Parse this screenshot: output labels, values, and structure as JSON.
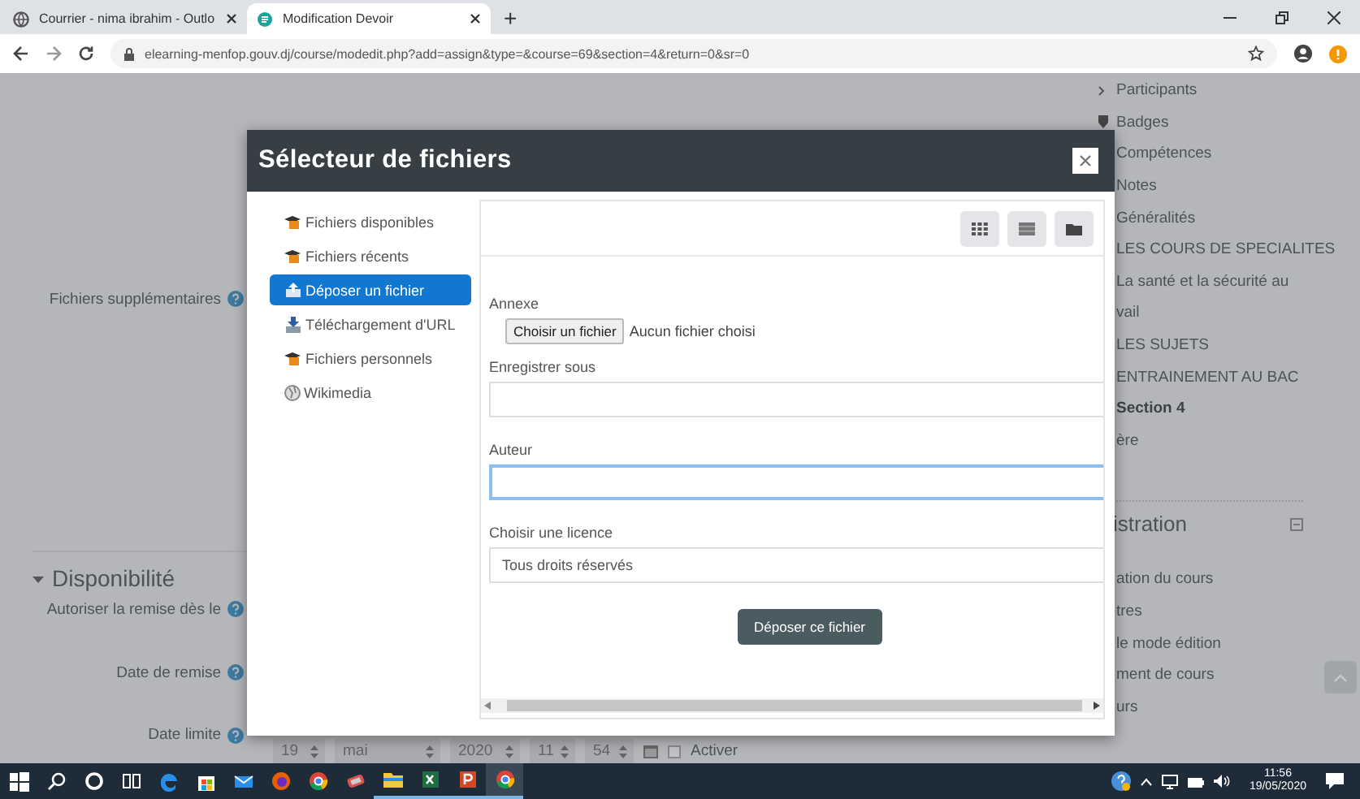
{
  "browser": {
    "tabs": [
      {
        "title": "Courrier - nima ibrahim - Outlo",
        "selected": false
      },
      {
        "title": "Modification Devoir",
        "selected": true
      }
    ],
    "new_tab": "+",
    "address": "elearning-menfop.gouv.dj/course/modedit.php?add=assign&type=&course=69&section=4&return=0&sr=0"
  },
  "form": {
    "field_label": "Fichiers supplémentaires",
    "section": {
      "title": "Disponibilité",
      "expanded": true
    },
    "date_rows": [
      {
        "label": "Autoriser la remise dès le"
      },
      {
        "label": "Date de remise"
      },
      {
        "label": "Date limite"
      }
    ],
    "date_selects": [
      "19",
      "mai",
      "2020",
      "11",
      "54"
    ],
    "enable": {
      "label": "Activer",
      "checked": false
    }
  },
  "sidebar": {
    "items": [
      {
        "label": "Participants",
        "kind": "link",
        "selected": false
      },
      {
        "label": "Badges",
        "kind": "badge",
        "selected": false
      },
      {
        "label": "Compétences",
        "kind": "text",
        "selected": false
      },
      {
        "label": "Notes",
        "kind": "text",
        "selected": false
      },
      {
        "label": "Généralités",
        "kind": "text",
        "selected": false
      },
      {
        "label": "LES COURS DE SPECIALITES",
        "kind": "text",
        "selected": false
      },
      {
        "label": "La santé et la sécurité au",
        "kind": "text",
        "selected": false
      },
      {
        "label": "vail",
        "kind": "text",
        "selected": false
      },
      {
        "label": "LES SUJETS",
        "kind": "text",
        "selected": false
      },
      {
        "label": "ENTRAINEMENT AU BAC",
        "kind": "text",
        "selected": false
      },
      {
        "label": "Section 4",
        "kind": "text",
        "selected": true
      },
      {
        "label": "ère",
        "kind": "text",
        "selected": false
      }
    ],
    "block": {
      "title": "istration",
      "items": [
        "ation du cours",
        "tres",
        "le mode édition",
        "ment de cours",
        "urs"
      ]
    }
  },
  "dialog": {
    "title": "Sélecteur de fichiers",
    "repositories": [
      {
        "label": "Fichiers disponibles",
        "kind": "files",
        "selected": false
      },
      {
        "label": "Fichiers récents",
        "kind": "files",
        "selected": false
      },
      {
        "label": "Déposer un fichier",
        "kind": "upload",
        "selected": true
      },
      {
        "label": "Téléchargement d'URL",
        "kind": "url",
        "selected": false
      },
      {
        "label": "Fichiers personnels",
        "kind": "files",
        "selected": false
      },
      {
        "label": "Wikimedia",
        "kind": "globe",
        "selected": false
      }
    ],
    "fields": [
      {
        "label": "Annexe",
        "kind": "file",
        "button": "Choisir un fichier",
        "status": "Aucun fichier choisi"
      },
      {
        "label": "Enregistrer sous",
        "kind": "text",
        "focused": false
      },
      {
        "label": "Auteur",
        "kind": "text",
        "focused": true
      },
      {
        "label": "Choisir une licence",
        "kind": "select",
        "value": "Tous droits réservés"
      }
    ],
    "submit": "Déposer ce fichier"
  },
  "taskbar": {
    "time": "11:56",
    "date": "19/05/2020"
  }
}
